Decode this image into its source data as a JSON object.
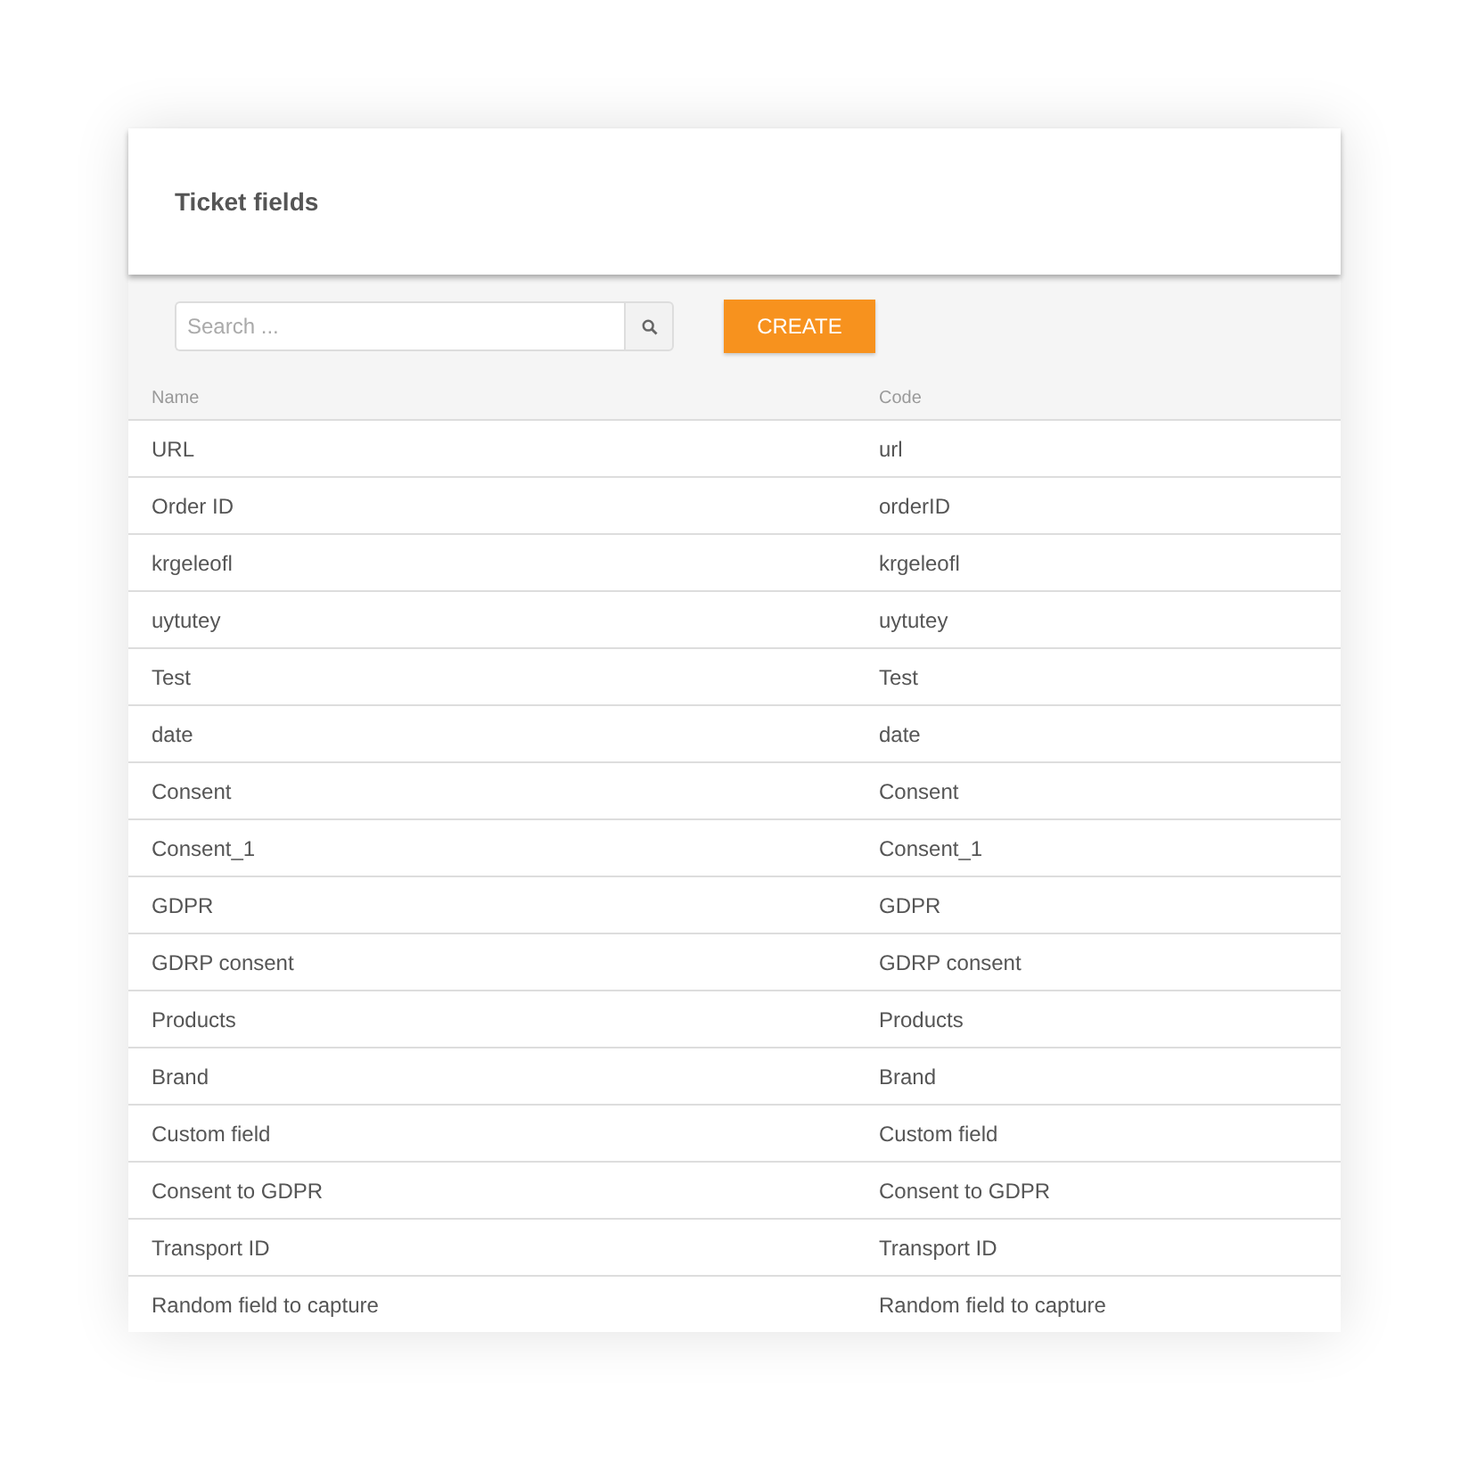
{
  "title": "Ticket fields",
  "search": {
    "placeholder": "Search ..."
  },
  "create_button": "CREATE",
  "table": {
    "columns": [
      "Name",
      "Code"
    ],
    "rows": [
      [
        "URL",
        "url"
      ],
      [
        "Order ID",
        "orderID"
      ],
      [
        "krgeleofl",
        "krgeleofl"
      ],
      [
        "uytutey",
        "uytutey"
      ],
      [
        "Test",
        "Test"
      ],
      [
        "date",
        "date"
      ],
      [
        "Consent",
        "Consent"
      ],
      [
        "Consent_1",
        "Consent_1"
      ],
      [
        "GDPR",
        "GDPR"
      ],
      [
        "GDRP consent",
        "GDRP consent"
      ],
      [
        "Products",
        "Products"
      ],
      [
        "Brand",
        "Brand"
      ],
      [
        "Custom field",
        "Custom field"
      ],
      [
        "Consent to GDPR",
        "Consent to GDPR"
      ],
      [
        "Transport ID",
        "Transport ID"
      ],
      [
        "Random field to capture",
        "Random field to capture"
      ]
    ]
  }
}
